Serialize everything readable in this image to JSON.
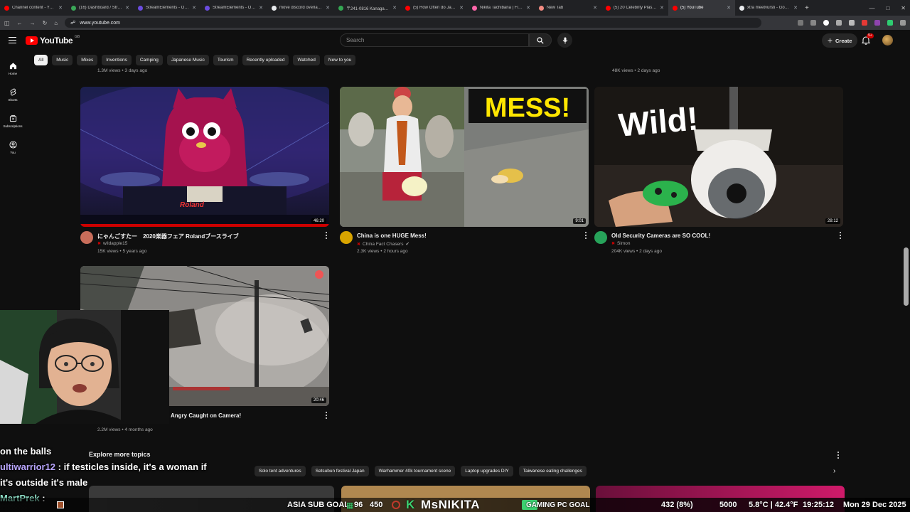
{
  "browser": {
    "tabs": [
      {
        "label": "Channel content - YouTube",
        "color": "#ff0000",
        "active": false
      },
      {
        "label": "(16) Dashboard / StreamElements",
        "color": "#3aa757",
        "active": false
      },
      {
        "label": "StreamElements - Overlays",
        "color": "#6b4ce0",
        "active": false
      },
      {
        "label": "StreamElements - Overlays",
        "color": "#6b4ce0",
        "active": false
      },
      {
        "label": "move discord overlay in OBS",
        "color": "#e8eaed",
        "active": false
      },
      {
        "label": "〒241-0816 Kanagawa, Yokohama",
        "color": "#34a853",
        "active": false
      },
      {
        "label": "(5) How Often do Japanese",
        "color": "#ff0000",
        "active": false
      },
      {
        "label": "Nikita Tachibana | Flickr",
        "color": "#ff66aa",
        "active": false
      },
      {
        "label": "New Tab",
        "color": "#f28b82",
        "active": false
      },
      {
        "label": "(5) 20 Celebrity Plastic Surgery",
        "color": "#ff0000",
        "active": false
      },
      {
        "label": "(5) YouTube",
        "color": "#ff0000",
        "active": true
      },
      {
        "label": "xtra meetvursti - Google Search",
        "color": "#e8eaed",
        "active": false
      }
    ],
    "new_tab_symbol": "+",
    "url": "www.youtube.com"
  },
  "header": {
    "logo_text": "YouTube",
    "country_code": "GB",
    "search_placeholder": "Search",
    "create_label": "Create",
    "notification_count": "9+"
  },
  "chips": [
    {
      "label": "All",
      "active": true
    },
    {
      "label": "Music",
      "active": false
    },
    {
      "label": "Mixes",
      "active": false
    },
    {
      "label": "Inventions",
      "active": false
    },
    {
      "label": "Camping",
      "active": false
    },
    {
      "label": "Japanese Music",
      "active": false
    },
    {
      "label": "Tourism",
      "active": false
    },
    {
      "label": "Recently uploaded",
      "active": false
    },
    {
      "label": "Watched",
      "active": false
    },
    {
      "label": "New to you",
      "active": false
    }
  ],
  "nav": {
    "home": "Home",
    "shorts": "Shorts",
    "subscriptions": "Subscriptions",
    "you": "You"
  },
  "previous_row": {
    "left_meta": "1.3M views • 3 days ago",
    "right_meta": "48K views • 2 days ago"
  },
  "videos": [
    {
      "title": "にゃんごすたー　2020楽器フェア Rolandブースライブ",
      "channel": "wildapple15",
      "meta": "15K views • 5 years ago",
      "duration": "46:20",
      "avatar_color": "#c86d5a"
    },
    {
      "title": "China is one HUGE Mess!",
      "channel": "China Fact Chasers",
      "meta": "2.3K views • 2 hours ago",
      "duration": "9:01",
      "avatar_color": "#d8a400",
      "thumb_text": "MESS!"
    },
    {
      "title": "Old Security Cameras are SO COOL!",
      "channel": "Simon",
      "meta": "204K views • 2 days ago",
      "duration": "28:12",
      "avatar_color": "#27a35a",
      "thumb_text": "Wild!"
    },
    {
      "title": "Angry Caught on Camera!",
      "meta": "2.2M views • 4 months ago",
      "duration": "20:46"
    }
  ],
  "explore": {
    "heading": "Explore more topics",
    "topics": [
      "Solo tent adventures",
      "Setsubun festival Japan",
      "Warhammer 40k tournament scene",
      "Laptop upgrades DIY",
      "Taiwanese eating challenges"
    ]
  },
  "stream": {
    "chat": [
      {
        "text": "on the balls"
      },
      {
        "user": "ultiwarrior12",
        "text": "if testicles inside, it's a woman if"
      },
      {
        "text": "it's outside it's male"
      },
      {
        "user": "MartPrek"
      }
    ],
    "ticker": {
      "goal1": "ASIA SUB GOAL",
      "goal1_a": "96",
      "goal1_b": "450",
      "brand_letter": "K",
      "brand": "MsNIKITA",
      "goal2": "GAMING PC GOAL",
      "stat": "432 (8%)",
      "count": "5000",
      "weather": "5.8°C | 42.4°F",
      "time": "19:25:12",
      "date": "Mon 29 Dec 2025"
    }
  }
}
